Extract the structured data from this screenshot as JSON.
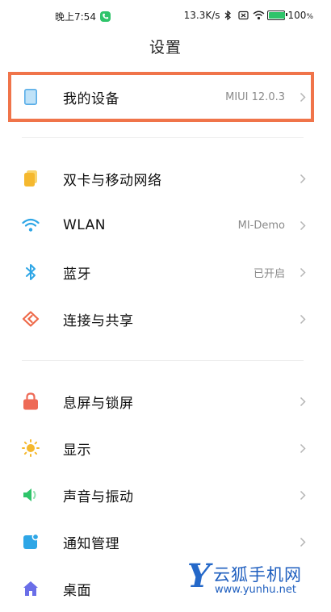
{
  "status_bar": {
    "time": "晚上7:54",
    "net_speed": "13.3K/s",
    "battery": "100",
    "battery_unit": "%",
    "battery_level": 1.0,
    "icons": [
      "call-icon",
      "bluetooth-icon",
      "sim-off-icon",
      "wifi-icon",
      "battery-icon"
    ]
  },
  "page": {
    "title": "设置"
  },
  "rows": [
    {
      "label": "我的设备",
      "value": "MIUI 12.0.3",
      "icon": "phone-icon",
      "color": "#5aaee8"
    },
    {
      "label": "双卡与移动网络",
      "value": "",
      "icon": "sim-card-icon",
      "color": "#f5b82e"
    },
    {
      "label": "WLAN",
      "value": "MI-Demo",
      "icon": "wifi-icon",
      "color": "#2ea6e6"
    },
    {
      "label": "蓝牙",
      "value": "已开启",
      "icon": "bluetooth-icon",
      "color": "#2ea6e6"
    },
    {
      "label": "连接与共享",
      "value": "",
      "icon": "share-icon",
      "color": "#ee6a4a"
    },
    {
      "label": "息屏与锁屏",
      "value": "",
      "icon": "lock-icon",
      "color": "#ee6a56"
    },
    {
      "label": "显示",
      "value": "",
      "icon": "sun-icon",
      "color": "#f5b82e"
    },
    {
      "label": "声音与振动",
      "value": "",
      "icon": "speaker-icon",
      "color": "#2fc46a"
    },
    {
      "label": "通知管理",
      "value": "",
      "icon": "notification-icon",
      "color": "#2ea6e6"
    },
    {
      "label": "桌面",
      "value": "",
      "icon": "home-icon",
      "color": "#6a6ee8"
    }
  ],
  "watermark": {
    "letter": "Y",
    "name": "云狐手机网",
    "url": "www.yunhu.net"
  },
  "colors": {
    "highlight": "#f0744a"
  }
}
